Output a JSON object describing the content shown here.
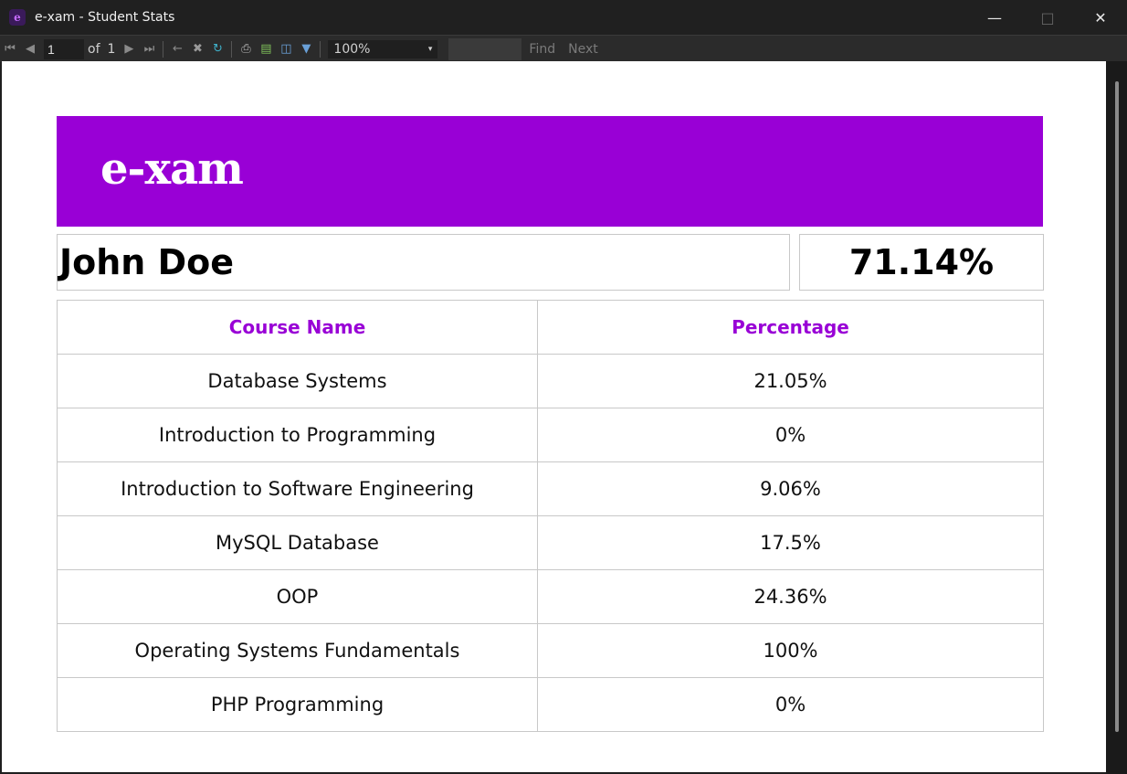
{
  "window": {
    "title": "e-xam - Student Stats",
    "app_icon_letter": "e"
  },
  "toolbar": {
    "page_current": "1",
    "of_label": "of",
    "page_total": "1",
    "zoom": "100%",
    "find_label": "Find",
    "next_label": "Next"
  },
  "report": {
    "logo_text": "e-xam",
    "student_name": "John Doe",
    "overall_score": "71.14%",
    "table": {
      "headers": [
        "Course Name",
        "Percentage"
      ],
      "rows": [
        {
          "course": "Database Systems",
          "percentage": "21.05%"
        },
        {
          "course": "Introduction to Programming",
          "percentage": "0%"
        },
        {
          "course": "Introduction to Software Engineering",
          "percentage": "9.06%"
        },
        {
          "course": "MySQL Database",
          "percentage": "17.5%"
        },
        {
          "course": "OOP",
          "percentage": "24.36%"
        },
        {
          "course": "Operating Systems Fundamentals",
          "percentage": "100%"
        },
        {
          "course": "PHP Programming",
          "percentage": "0%"
        }
      ]
    }
  },
  "colors": {
    "brand_purple": "#9900d6",
    "titlebar_bg": "#202020",
    "toolbar_bg": "#2b2b2b"
  }
}
